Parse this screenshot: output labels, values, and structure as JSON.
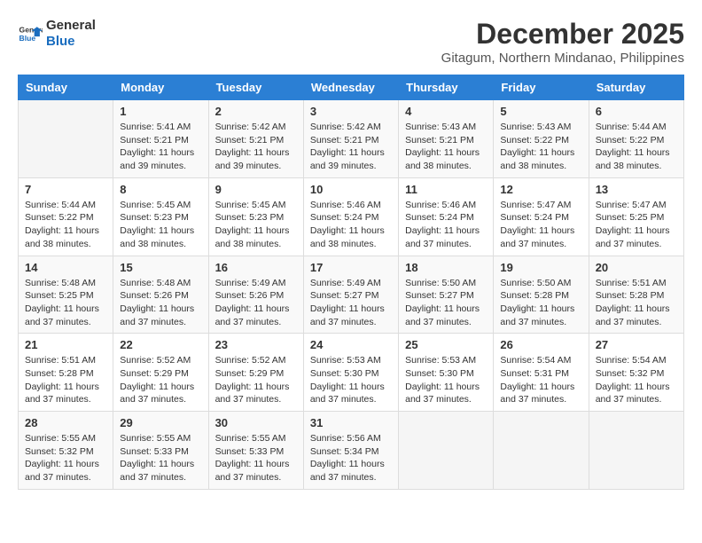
{
  "logo": {
    "line1": "General",
    "line2": "Blue"
  },
  "title": "December 2025",
  "location": "Gitagum, Northern Mindanao, Philippines",
  "header": {
    "days": [
      "Sunday",
      "Monday",
      "Tuesday",
      "Wednesday",
      "Thursday",
      "Friday",
      "Saturday"
    ]
  },
  "weeks": [
    [
      {
        "day": "",
        "info": ""
      },
      {
        "day": "1",
        "info": "Sunrise: 5:41 AM\nSunset: 5:21 PM\nDaylight: 11 hours\nand 39 minutes."
      },
      {
        "day": "2",
        "info": "Sunrise: 5:42 AM\nSunset: 5:21 PM\nDaylight: 11 hours\nand 39 minutes."
      },
      {
        "day": "3",
        "info": "Sunrise: 5:42 AM\nSunset: 5:21 PM\nDaylight: 11 hours\nand 39 minutes."
      },
      {
        "day": "4",
        "info": "Sunrise: 5:43 AM\nSunset: 5:21 PM\nDaylight: 11 hours\nand 38 minutes."
      },
      {
        "day": "5",
        "info": "Sunrise: 5:43 AM\nSunset: 5:22 PM\nDaylight: 11 hours\nand 38 minutes."
      },
      {
        "day": "6",
        "info": "Sunrise: 5:44 AM\nSunset: 5:22 PM\nDaylight: 11 hours\nand 38 minutes."
      }
    ],
    [
      {
        "day": "7",
        "info": "Sunrise: 5:44 AM\nSunset: 5:22 PM\nDaylight: 11 hours\nand 38 minutes."
      },
      {
        "day": "8",
        "info": "Sunrise: 5:45 AM\nSunset: 5:23 PM\nDaylight: 11 hours\nand 38 minutes."
      },
      {
        "day": "9",
        "info": "Sunrise: 5:45 AM\nSunset: 5:23 PM\nDaylight: 11 hours\nand 38 minutes."
      },
      {
        "day": "10",
        "info": "Sunrise: 5:46 AM\nSunset: 5:24 PM\nDaylight: 11 hours\nand 38 minutes."
      },
      {
        "day": "11",
        "info": "Sunrise: 5:46 AM\nSunset: 5:24 PM\nDaylight: 11 hours\nand 37 minutes."
      },
      {
        "day": "12",
        "info": "Sunrise: 5:47 AM\nSunset: 5:24 PM\nDaylight: 11 hours\nand 37 minutes."
      },
      {
        "day": "13",
        "info": "Sunrise: 5:47 AM\nSunset: 5:25 PM\nDaylight: 11 hours\nand 37 minutes."
      }
    ],
    [
      {
        "day": "14",
        "info": "Sunrise: 5:48 AM\nSunset: 5:25 PM\nDaylight: 11 hours\nand 37 minutes."
      },
      {
        "day": "15",
        "info": "Sunrise: 5:48 AM\nSunset: 5:26 PM\nDaylight: 11 hours\nand 37 minutes."
      },
      {
        "day": "16",
        "info": "Sunrise: 5:49 AM\nSunset: 5:26 PM\nDaylight: 11 hours\nand 37 minutes."
      },
      {
        "day": "17",
        "info": "Sunrise: 5:49 AM\nSunset: 5:27 PM\nDaylight: 11 hours\nand 37 minutes."
      },
      {
        "day": "18",
        "info": "Sunrise: 5:50 AM\nSunset: 5:27 PM\nDaylight: 11 hours\nand 37 minutes."
      },
      {
        "day": "19",
        "info": "Sunrise: 5:50 AM\nSunset: 5:28 PM\nDaylight: 11 hours\nand 37 minutes."
      },
      {
        "day": "20",
        "info": "Sunrise: 5:51 AM\nSunset: 5:28 PM\nDaylight: 11 hours\nand 37 minutes."
      }
    ],
    [
      {
        "day": "21",
        "info": "Sunrise: 5:51 AM\nSunset: 5:28 PM\nDaylight: 11 hours\nand 37 minutes."
      },
      {
        "day": "22",
        "info": "Sunrise: 5:52 AM\nSunset: 5:29 PM\nDaylight: 11 hours\nand 37 minutes."
      },
      {
        "day": "23",
        "info": "Sunrise: 5:52 AM\nSunset: 5:29 PM\nDaylight: 11 hours\nand 37 minutes."
      },
      {
        "day": "24",
        "info": "Sunrise: 5:53 AM\nSunset: 5:30 PM\nDaylight: 11 hours\nand 37 minutes."
      },
      {
        "day": "25",
        "info": "Sunrise: 5:53 AM\nSunset: 5:30 PM\nDaylight: 11 hours\nand 37 minutes."
      },
      {
        "day": "26",
        "info": "Sunrise: 5:54 AM\nSunset: 5:31 PM\nDaylight: 11 hours\nand 37 minutes."
      },
      {
        "day": "27",
        "info": "Sunrise: 5:54 AM\nSunset: 5:32 PM\nDaylight: 11 hours\nand 37 minutes."
      }
    ],
    [
      {
        "day": "28",
        "info": "Sunrise: 5:55 AM\nSunset: 5:32 PM\nDaylight: 11 hours\nand 37 minutes."
      },
      {
        "day": "29",
        "info": "Sunrise: 5:55 AM\nSunset: 5:33 PM\nDaylight: 11 hours\nand 37 minutes."
      },
      {
        "day": "30",
        "info": "Sunrise: 5:55 AM\nSunset: 5:33 PM\nDaylight: 11 hours\nand 37 minutes."
      },
      {
        "day": "31",
        "info": "Sunrise: 5:56 AM\nSunset: 5:34 PM\nDaylight: 11 hours\nand 37 minutes."
      },
      {
        "day": "",
        "info": ""
      },
      {
        "day": "",
        "info": ""
      },
      {
        "day": "",
        "info": ""
      }
    ]
  ]
}
